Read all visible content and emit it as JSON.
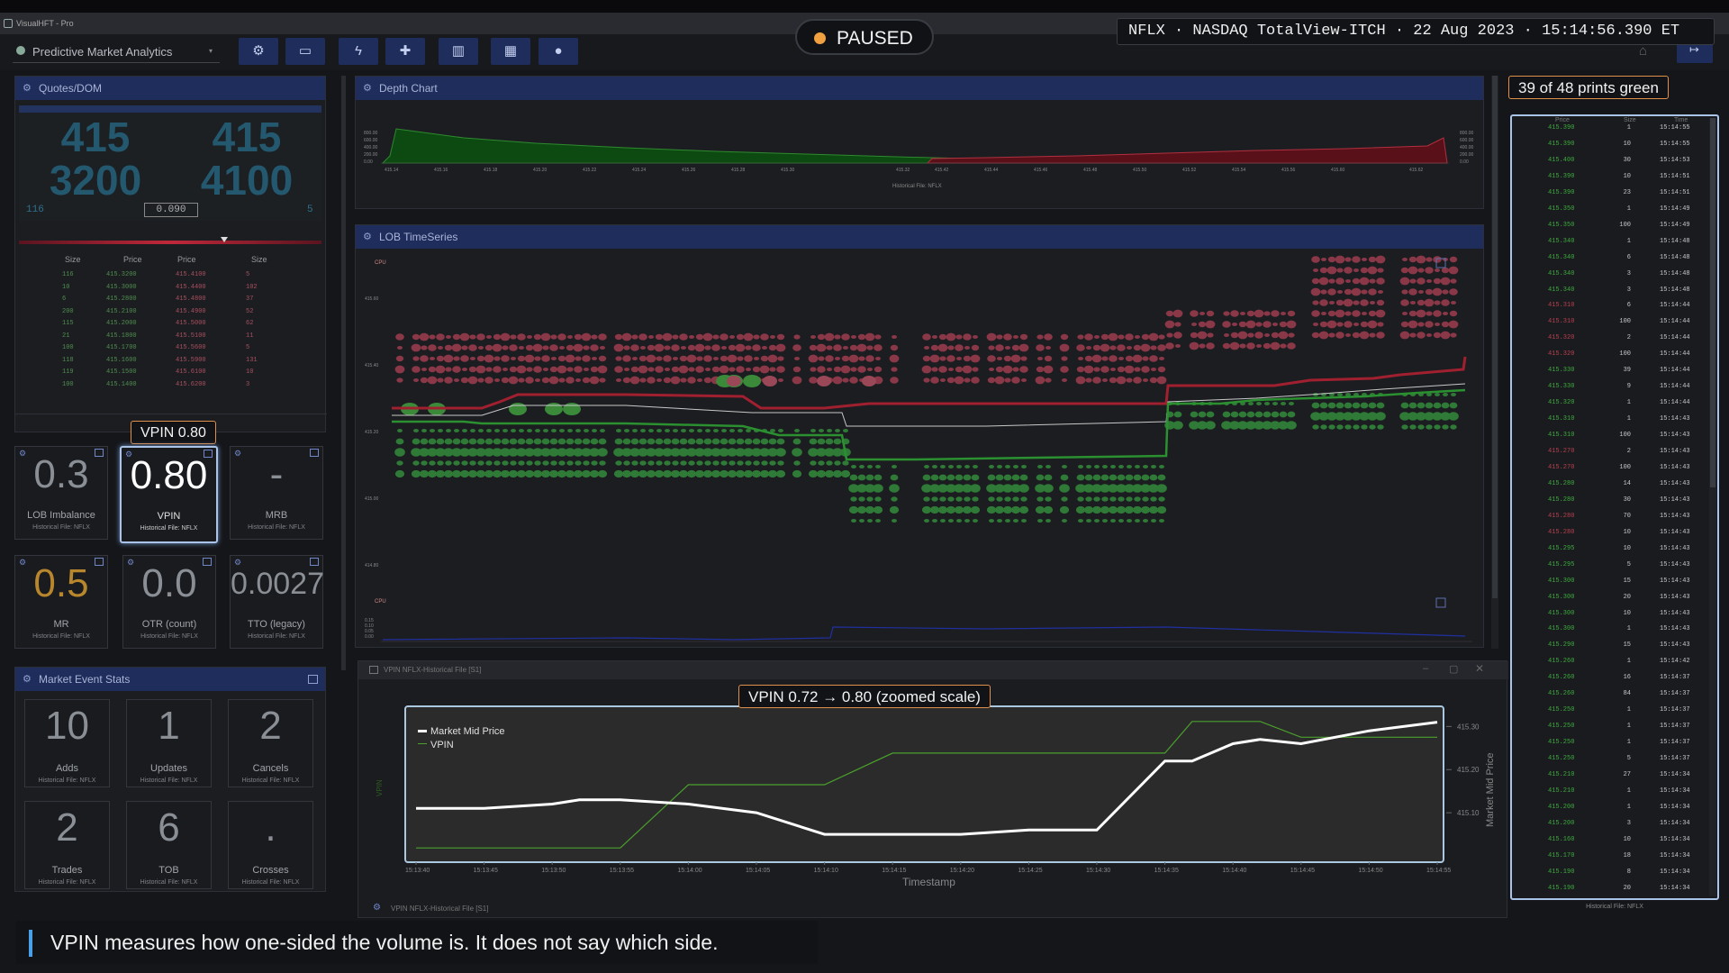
{
  "window": {
    "title": "VisualHFT - Pro",
    "app_title": "Predictive Market Analytics",
    "toolbar_icons": [
      "gear-icon",
      "monitor-icon",
      "lightning-icon",
      "puzzle-icon",
      "chart-icon",
      "grid-icon",
      "user-icon"
    ]
  },
  "paused_badge": {
    "label": "PAUSED",
    "dot_color": "#f0a040"
  },
  "header_info": "NFLX · NASDAQ TotalView-ITCH · 22 Aug 2023 · 15:14:56.390 ET",
  "quotes": {
    "title": "Quotes/DOM",
    "bid_top": "415",
    "bid_bottom": "3200",
    "ask_top": "415",
    "ask_bottom": "4100",
    "bid_size": "116",
    "spread": "0.090",
    "ask_size": "5",
    "headers": [
      "Size",
      "Price",
      "Price",
      "Size"
    ],
    "rows": [
      {
        "bid_size": "116",
        "bid_price": "415.3200",
        "ask_price": "415.4100",
        "ask_size": "5"
      },
      {
        "bid_size": "10",
        "bid_price": "415.3000",
        "ask_price": "415.4400",
        "ask_size": "102"
      },
      {
        "bid_size": "6",
        "bid_price": "415.2800",
        "ask_price": "415.4800",
        "ask_size": "37"
      },
      {
        "bid_size": "200",
        "bid_price": "415.2100",
        "ask_price": "415.4900",
        "ask_size": "52"
      },
      {
        "bid_size": "115",
        "bid_price": "415.2000",
        "ask_price": "415.5000",
        "ask_size": "62"
      },
      {
        "bid_size": "21",
        "bid_price": "415.1800",
        "ask_price": "415.5100",
        "ask_size": "11"
      },
      {
        "bid_size": "100",
        "bid_price": "415.1700",
        "ask_price": "415.5600",
        "ask_size": "5"
      },
      {
        "bid_size": "118",
        "bid_price": "415.1600",
        "ask_price": "415.5900",
        "ask_size": "131"
      },
      {
        "bid_size": "119",
        "bid_price": "415.1500",
        "ask_price": "415.6100",
        "ask_size": "10"
      },
      {
        "bid_size": "100",
        "bid_price": "415.1400",
        "ask_price": "415.6200",
        "ask_size": "3"
      }
    ]
  },
  "metrics": [
    {
      "value": "0.3",
      "label": "LOB Imbalance",
      "source": "Historical File: NFLX",
      "color": "#8a8f96"
    },
    {
      "value": "0.80",
      "label": "VPIN",
      "source": "Historical File: NFLX",
      "color": "#ffffff"
    },
    {
      "value": "-",
      "label": "MRB",
      "source": "Historical File: NFLX",
      "color": "#8a8f96"
    },
    {
      "value": "0.5",
      "label": "MR",
      "source": "Historical File: NFLX",
      "color": "#b8862c"
    },
    {
      "value": "0.0",
      "label": "OTR (count)",
      "source": "Historical File: NFLX",
      "color": "#8a8f96"
    },
    {
      "value": "0.0027",
      "label": "TTO (legacy)",
      "source": "Historical File: NFLX",
      "color": "#8a8f96"
    }
  ],
  "vpin_callout": "VPIN 0.80",
  "market_event_stats": {
    "title": "Market Event Stats",
    "items": [
      {
        "value": "10",
        "label": "Adds",
        "source": "Historical File: NFLX"
      },
      {
        "value": "1",
        "label": "Updates",
        "source": "Historical File: NFLX"
      },
      {
        "value": "2",
        "label": "Cancels",
        "source": "Historical File: NFLX"
      },
      {
        "value": "2",
        "label": "Trades",
        "source": "Historical File: NFLX"
      },
      {
        "value": "6",
        "label": "TOB",
        "source": "Historical File: NFLX"
      },
      {
        "value": ".",
        "label": "Crosses",
        "source": "Historical File: NFLX"
      }
    ]
  },
  "depth_chart": {
    "title": "Depth Chart",
    "footer": "Historical File: NFLX",
    "y_ticks": [
      "800.00",
      "600.00",
      "400.00",
      "200.00",
      "0.00"
    ],
    "bid_ticks": [
      "415.14",
      "415.16",
      "415.18",
      "415.20",
      "415.22",
      "415.24",
      "415.26",
      "415.28",
      "415.30",
      "415.32"
    ],
    "ask_ticks": [
      "415.42",
      "415.44",
      "415.46",
      "415.48",
      "415.50",
      "415.52",
      "415.54",
      "415.56",
      "415.60",
      "415.62"
    ]
  },
  "lob_timeseries": {
    "title": "LOB TimeSeries",
    "cpu_label": "CPU",
    "cpu_label2": "CPU",
    "y_ticks": [
      "415.60",
      "415.40",
      "415.20",
      "415.00",
      "414.80"
    ],
    "cpu_ticks": [
      "0.15",
      "0.10",
      "0.05",
      "0.00"
    ]
  },
  "vpin_window": {
    "title": "VPIN NFLX-Historical File [S1]",
    "footer": "VPIN NFLX-Historical File [S1]",
    "callout": "VPIN 0.72 → 0.80 (zoomed scale)",
    "legend": [
      "Market Mid Price",
      "VPIN"
    ],
    "x_label": "Timestamp",
    "y_right_label": "Market Mid Price",
    "y_left_label": "VPIN",
    "y_ticks": [
      "415.30",
      "415.20",
      "415.10"
    ],
    "x_ticks": [
      "15:13:40",
      "15:13:45",
      "15:13:50",
      "15:13:55",
      "15:14:00",
      "15:14:05",
      "15:14:10",
      "15:14:15",
      "15:14:20",
      "15:14:25",
      "15:14:30",
      "15:14:35",
      "15:14:40",
      "15:14:45",
      "15:14:50",
      "15:14:55"
    ]
  },
  "chart_data": {
    "type": "line",
    "x_label": "Timestamp",
    "x": [
      "15:13:40",
      "15:13:45",
      "15:13:50",
      "15:13:52",
      "15:13:55",
      "15:14:00",
      "15:14:05",
      "15:14:10",
      "15:14:15",
      "15:14:20",
      "15:14:25",
      "15:14:30",
      "15:14:35",
      "15:14:37",
      "15:14:40",
      "15:14:42",
      "15:14:45",
      "15:14:50",
      "15:14:55"
    ],
    "series": [
      {
        "name": "Market Mid Price",
        "color": "#ffffff",
        "axis": "right",
        "values": [
          415.11,
          415.11,
          415.12,
          415.13,
          415.13,
          415.12,
          415.1,
          415.05,
          415.05,
          415.05,
          415.06,
          415.06,
          415.22,
          415.22,
          415.26,
          415.27,
          415.26,
          415.29,
          415.31
        ]
      },
      {
        "name": "VPIN",
        "color": "#4aa02c",
        "axis": "left",
        "values": [
          0.72,
          0.72,
          0.72,
          0.72,
          0.72,
          0.76,
          0.76,
          0.76,
          0.78,
          0.78,
          0.78,
          0.78,
          0.78,
          0.8,
          0.8,
          0.8,
          0.79,
          0.79,
          0.79
        ]
      }
    ],
    "y_right_ticks": [
      415.1,
      415.2,
      415.3
    ]
  },
  "trades_tape": {
    "callout": "39 of 48 prints green",
    "headers": [
      "Price",
      "Size",
      "Time"
    ],
    "footer": "Historical File: NFLX",
    "rows": [
      {
        "p": "415.390",
        "s": "1",
        "t": "15:14:55",
        "c": "g"
      },
      {
        "p": "415.390",
        "s": "10",
        "t": "15:14:55",
        "c": "g"
      },
      {
        "p": "415.400",
        "s": "30",
        "t": "15:14:53",
        "c": "g"
      },
      {
        "p": "415.390",
        "s": "10",
        "t": "15:14:51",
        "c": "g"
      },
      {
        "p": "415.390",
        "s": "23",
        "t": "15:14:51",
        "c": "g"
      },
      {
        "p": "415.350",
        "s": "1",
        "t": "15:14:49",
        "c": "g"
      },
      {
        "p": "415.350",
        "s": "100",
        "t": "15:14:49",
        "c": "g"
      },
      {
        "p": "415.340",
        "s": "1",
        "t": "15:14:48",
        "c": "g"
      },
      {
        "p": "415.340",
        "s": "6",
        "t": "15:14:48",
        "c": "g"
      },
      {
        "p": "415.340",
        "s": "3",
        "t": "15:14:48",
        "c": "g"
      },
      {
        "p": "415.340",
        "s": "3",
        "t": "15:14:48",
        "c": "g"
      },
      {
        "p": "415.310",
        "s": "6",
        "t": "15:14:44",
        "c": "r"
      },
      {
        "p": "415.310",
        "s": "100",
        "t": "15:14:44",
        "c": "r"
      },
      {
        "p": "415.320",
        "s": "2",
        "t": "15:14:44",
        "c": "r"
      },
      {
        "p": "415.320",
        "s": "100",
        "t": "15:14:44",
        "c": "r"
      },
      {
        "p": "415.330",
        "s": "39",
        "t": "15:14:44",
        "c": "g"
      },
      {
        "p": "415.330",
        "s": "9",
        "t": "15:14:44",
        "c": "g"
      },
      {
        "p": "415.320",
        "s": "1",
        "t": "15:14:44",
        "c": "g"
      },
      {
        "p": "415.310",
        "s": "1",
        "t": "15:14:43",
        "c": "g"
      },
      {
        "p": "415.310",
        "s": "100",
        "t": "15:14:43",
        "c": "g"
      },
      {
        "p": "415.270",
        "s": "2",
        "t": "15:14:43",
        "c": "r"
      },
      {
        "p": "415.270",
        "s": "100",
        "t": "15:14:43",
        "c": "r"
      },
      {
        "p": "415.280",
        "s": "14",
        "t": "15:14:43",
        "c": "g"
      },
      {
        "p": "415.280",
        "s": "30",
        "t": "15:14:43",
        "c": "g"
      },
      {
        "p": "415.280",
        "s": "70",
        "t": "15:14:43",
        "c": "r"
      },
      {
        "p": "415.280",
        "s": "10",
        "t": "15:14:43",
        "c": "r"
      },
      {
        "p": "415.295",
        "s": "10",
        "t": "15:14:43",
        "c": "g"
      },
      {
        "p": "415.295",
        "s": "5",
        "t": "15:14:43",
        "c": "g"
      },
      {
        "p": "415.300",
        "s": "15",
        "t": "15:14:43",
        "c": "g"
      },
      {
        "p": "415.300",
        "s": "20",
        "t": "15:14:43",
        "c": "g"
      },
      {
        "p": "415.300",
        "s": "10",
        "t": "15:14:43",
        "c": "g"
      },
      {
        "p": "415.300",
        "s": "1",
        "t": "15:14:43",
        "c": "g"
      },
      {
        "p": "415.290",
        "s": "15",
        "t": "15:14:43",
        "c": "g"
      },
      {
        "p": "415.260",
        "s": "1",
        "t": "15:14:42",
        "c": "g"
      },
      {
        "p": "415.260",
        "s": "16",
        "t": "15:14:37",
        "c": "g"
      },
      {
        "p": "415.260",
        "s": "84",
        "t": "15:14:37",
        "c": "g"
      },
      {
        "p": "415.250",
        "s": "1",
        "t": "15:14:37",
        "c": "g"
      },
      {
        "p": "415.250",
        "s": "1",
        "t": "15:14:37",
        "c": "g"
      },
      {
        "p": "415.250",
        "s": "1",
        "t": "15:14:37",
        "c": "g"
      },
      {
        "p": "415.250",
        "s": "5",
        "t": "15:14:37",
        "c": "g"
      },
      {
        "p": "415.210",
        "s": "27",
        "t": "15:14:34",
        "c": "g"
      },
      {
        "p": "415.210",
        "s": "1",
        "t": "15:14:34",
        "c": "g"
      },
      {
        "p": "415.200",
        "s": "1",
        "t": "15:14:34",
        "c": "g"
      },
      {
        "p": "415.200",
        "s": "3",
        "t": "15:14:34",
        "c": "g"
      },
      {
        "p": "415.160",
        "s": "10",
        "t": "15:14:34",
        "c": "g"
      },
      {
        "p": "415.170",
        "s": "18",
        "t": "15:14:34",
        "c": "g"
      },
      {
        "p": "415.190",
        "s": "8",
        "t": "15:14:34",
        "c": "g"
      },
      {
        "p": "415.190",
        "s": "20",
        "t": "15:14:34",
        "c": "g"
      }
    ]
  },
  "caption": "VPIN measures how one-sided the volume is. It does not say which side.",
  "colors": {
    "accent": "#1f2d5c",
    "bid": "#3f9a3f",
    "ask": "#a84050",
    "callout_border": "#e0904a"
  }
}
